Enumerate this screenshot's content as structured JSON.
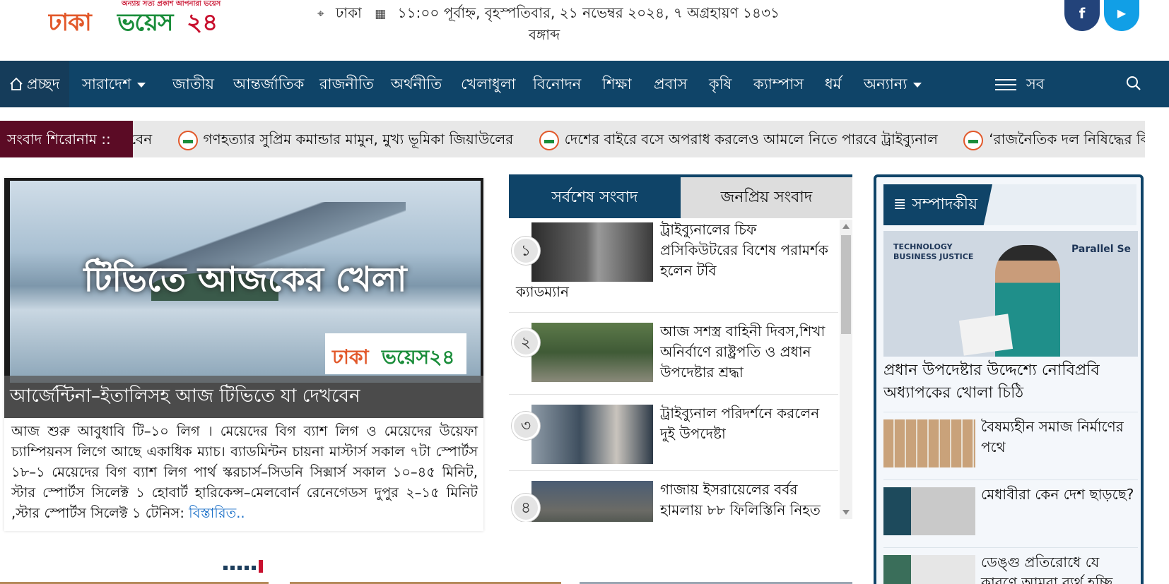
{
  "header": {
    "logo_tagline": "অন্যায় সত্য প্রকাশ আপনারা ভয়েস",
    "logo_part1": "ঢাকা",
    "logo_part2": "ভয়েস",
    "logo_part3": "২৪",
    "location": "ঢাকা",
    "datetime_line1": "১১:০০ পূর্বাহ্ন, বৃহস্পতিবার, ২১ নভেম্বর ২০২৪, ৭ অগ্রহায়ণ ১৪৩১",
    "datetime_line2": "বঙ্গাব্দ",
    "social": {
      "facebook_icon": "f",
      "youtube_icon": "▶"
    }
  },
  "nav": {
    "home": "প্রচ্ছদ",
    "items": [
      "সারাদেশ",
      "জাতীয়",
      "আন্তর্জাতিক",
      "রাজনীতি",
      "অর্থনীতি",
      "খেলাধুলা",
      "বিনোদন",
      "শিক্ষা",
      "প্রবাস",
      "কৃষি",
      "ক্যাম্পাস",
      "ধর্ম",
      "অন্যান্য"
    ],
    "all": "সব"
  },
  "ticker": {
    "label": "সংবাদ শিরোনাম ::",
    "fragment": "বেন",
    "headlines": [
      "গণহত্যার সুপ্রিম কমান্ডার মামুন, মুখ্য ভূমিকা জিয়াউলের",
      "দেশের বাইরে বসে অপরাধ করলেও আমলে নিতে পারবে ট্রাইব্যুনাল",
      "‘রাজনৈতিক দল নিষিদ্ধের বি"
    ]
  },
  "lead": {
    "image_title": "টিভিতে আজকের খেলা",
    "image_logo_a": "ঢাকা",
    "image_logo_b": "ভয়েস২৪",
    "caption": "আর্জেন্টিনা–ইতালিসহ আজ টিভিতে যা দেখবেন",
    "body": "আজ শুরু আবুধাবি টি–১০ লিগ । মেয়েদের বিগ ব্যাশ লিগ ও মেয়েদের উয়েফা চ্যাম্পিয়নস লিগে আছে একাধিক ম্যাচ। ব্যাডমিন্টন চায়না মাস্টার্স সকাল ৭টা স্পোর্টস ১৮–১ মেয়েদের বিগ ব্যাশ লিগ পার্থ স্করচার্স–সিডনি সিক্সার্স সকাল ১০–৪৫ মিনিট, স্টার স্পোর্টস সিলেক্ট ১ হোবার্ট হারিকেন্স–মেলবোর্ন রেনেগেডস দুপুর ২–১৫ মিনিট ,স্টার স্পোর্টস সিলেক্ট ১ টেনিস: ",
    "more": "বিস্তারিত.."
  },
  "latest": {
    "tab_latest": "সর্বশেষ সংবাদ",
    "tab_popular": "জনপ্রিয় সংবাদ",
    "items": [
      {
        "num": "১",
        "title": "ট্রাইব্যুনালের চিফ প্রসিকিউটরের বিশেষ পরামর্শক হলেন টবি",
        "title_cont": "ক্যাডম্যান"
      },
      {
        "num": "২",
        "title": "আজ সশস্ত্র বাহিনী দিবস,শিখা অনির্বাণে রাষ্ট্রপতি ও প্রধান উপদেষ্টার শ্রদ্ধা"
      },
      {
        "num": "৩",
        "title": "ট্রাইব্যুনাল পরিদর্শনে  করলেন দুই উপদেষ্টা"
      },
      {
        "num": "৪",
        "title": "গাজায় ইসরায়েলের বর্বর হামলায় ৮৮ ফিলিস্তিনি নিহত"
      }
    ]
  },
  "editorial": {
    "heading": "সম্পাদকীয়",
    "lead_title": "প্রধান উপদেষ্টার উদ্দেশ্যে নোবিপ্রবি অধ্যাপকের খোলা চিঠি",
    "lead_image_text": "TECHNOLOGY BUSINESS JUSTICE",
    "lead_image_text2": "Parallel Se",
    "items": [
      "বৈষম্যহীন সমাজ নির্মাণের পথে",
      "মেধাবীরা কেন দেশ ছাড়ছে?",
      "ডেঙ্গু প্রতিরোধে যে কারণে আমরা ব্যর্থ হচ্ছি"
    ]
  },
  "colors": {
    "nav_bg": "#0f4468",
    "ticker_label_bg": "#5b0b25",
    "logo_orange": "#e2582a",
    "logo_green": "#1a8d3a",
    "link_blue": "#1a6fc7"
  }
}
